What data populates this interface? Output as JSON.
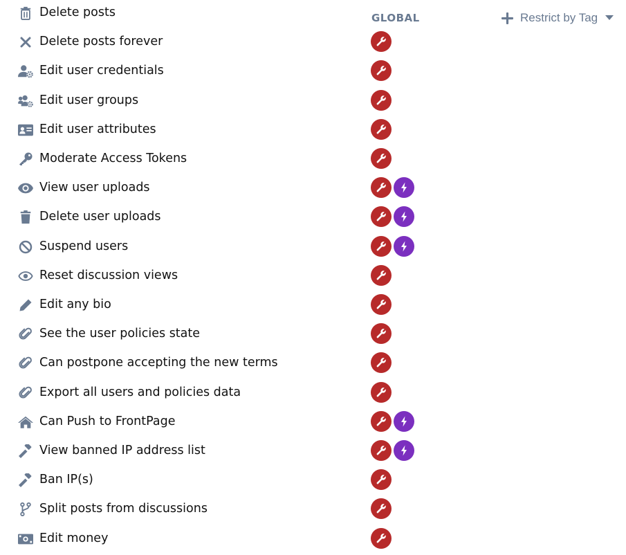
{
  "header": {
    "global_label": "GLOBAL",
    "restrict_label": "Restrict by Tag"
  },
  "colors": {
    "icon": "#697a91",
    "admin_badge": "#b72a2a",
    "mod_badge": "#7b2fbf"
  },
  "permissions": [
    {
      "label": "Delete posts",
      "icon": "trash-outline-icon",
      "badges": []
    },
    {
      "label": "Delete posts forever",
      "icon": "times-icon",
      "badges": [
        "admin"
      ]
    },
    {
      "label": "Edit user credentials",
      "icon": "user-cog-icon",
      "badges": [
        "admin"
      ]
    },
    {
      "label": "Edit user groups",
      "icon": "users-cog-icon",
      "badges": [
        "admin"
      ]
    },
    {
      "label": "Edit user attributes",
      "icon": "id-card-icon",
      "badges": [
        "admin"
      ]
    },
    {
      "label": "Moderate Access Tokens",
      "icon": "key-icon",
      "badges": [
        "admin"
      ]
    },
    {
      "label": "View user uploads",
      "icon": "eye-icon",
      "badges": [
        "admin",
        "mod"
      ]
    },
    {
      "label": "Delete user uploads",
      "icon": "trash-icon",
      "badges": [
        "admin",
        "mod"
      ]
    },
    {
      "label": "Suspend users",
      "icon": "ban-icon",
      "badges": [
        "admin",
        "mod"
      ]
    },
    {
      "label": "Reset discussion views",
      "icon": "eye-outline-icon",
      "badges": [
        "admin"
      ]
    },
    {
      "label": "Edit any bio",
      "icon": "pencil-icon",
      "badges": [
        "admin"
      ]
    },
    {
      "label": "See the user policies state",
      "icon": "paperclip-icon",
      "badges": [
        "admin"
      ]
    },
    {
      "label": "Can postpone accepting the new terms",
      "icon": "paperclip-icon",
      "badges": [
        "admin"
      ]
    },
    {
      "label": "Export all users and policies data",
      "icon": "paperclip-icon",
      "badges": [
        "admin"
      ]
    },
    {
      "label": "Can Push to FrontPage",
      "icon": "home-icon",
      "badges": [
        "admin",
        "mod"
      ]
    },
    {
      "label": "View banned IP address list",
      "icon": "gavel-icon",
      "badges": [
        "admin",
        "mod"
      ]
    },
    {
      "label": "Ban IP(s)",
      "icon": "gavel-icon",
      "badges": [
        "admin"
      ]
    },
    {
      "label": "Split posts from discussions",
      "icon": "code-branch-icon",
      "badges": [
        "admin"
      ]
    },
    {
      "label": "Edit money",
      "icon": "money-bill-icon",
      "badges": [
        "admin"
      ]
    }
  ]
}
